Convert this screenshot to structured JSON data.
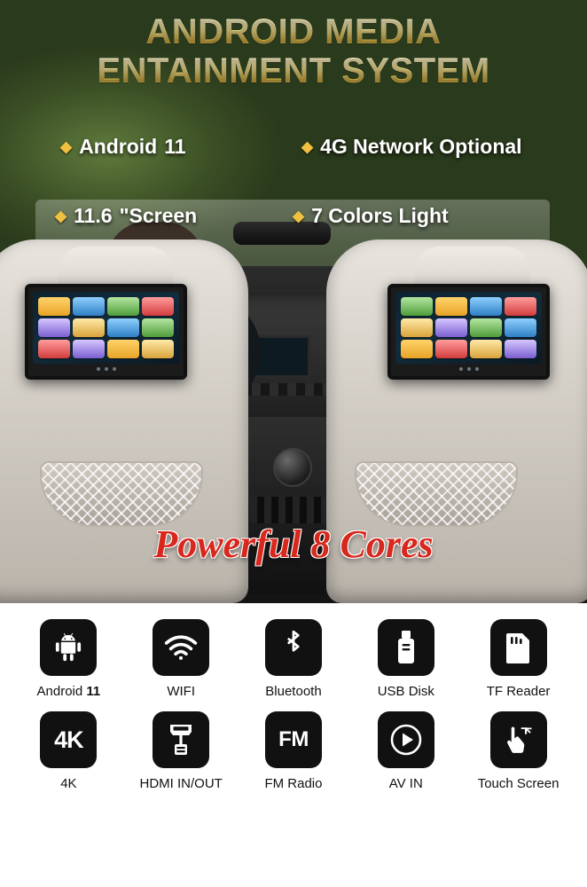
{
  "hero": {
    "title_line1": "ANDROID MEDIA",
    "title_line2": "ENTAINMENT SYSTEM",
    "features": [
      {
        "bullet": "◆",
        "label": "Android ",
        "value": "11"
      },
      {
        "bullet": "◆",
        "label": "4G Network Optional",
        "value": ""
      },
      {
        "bullet": "◆",
        "label": "",
        "value": "11.6",
        "suffix": "\"Screen"
      },
      {
        "bullet": "◆",
        "label": "7 Colors Light",
        "value": ""
      }
    ],
    "feature_texts": {
      "android": "Android",
      "android_version": "11",
      "network": "4G Network Optional",
      "screen_size": "11.6",
      "screen_unit": "\"Screen",
      "light": "7 Colors Light"
    },
    "banner": "Powerful 8 Cores",
    "colors": {
      "title_gold": "#f3e08f",
      "banner_red": "#d8271d",
      "bullet_gold": "#f0c040"
    }
  },
  "icon_grid": {
    "rows": [
      [
        {
          "icon": "android-icon",
          "label": "Android ",
          "label_bold": "11"
        },
        {
          "icon": "wifi-icon",
          "label": "WIFI",
          "label_bold": ""
        },
        {
          "icon": "bluetooth-icon",
          "label": "Bluetooth",
          "label_bold": ""
        },
        {
          "icon": "usb-disk-icon",
          "label": "USB Disk",
          "label_bold": ""
        },
        {
          "icon": "tf-card-icon",
          "label": "TF Reader",
          "label_bold": ""
        }
      ],
      [
        {
          "icon": "4k-icon",
          "label": "4K",
          "label_bold": "",
          "glyph": "4K"
        },
        {
          "icon": "hdmi-icon",
          "label": "HDMI IN/OUT",
          "label_bold": ""
        },
        {
          "icon": "fm-radio-icon",
          "label": "FM Radio",
          "label_bold": "",
          "glyph": "FM"
        },
        {
          "icon": "av-in-play-icon",
          "label": "AV IN",
          "label_bold": ""
        },
        {
          "icon": "touch-screen-icon",
          "label": "Touch Screen",
          "label_bold": ""
        }
      ]
    ]
  }
}
